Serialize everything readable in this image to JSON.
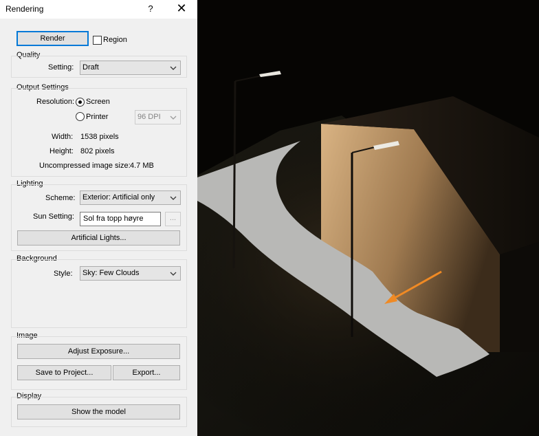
{
  "window": {
    "title": "Rendering",
    "help_glyph": "?",
    "close_glyph": "✕"
  },
  "render": {
    "button_label": "Render",
    "region_label": "Region",
    "region_checked": false
  },
  "quality": {
    "group_title": "Quality",
    "setting_label": "Setting:",
    "setting_value": "Draft"
  },
  "output": {
    "group_title": "Output Settings",
    "resolution_label": "Resolution:",
    "screen_label": "Screen",
    "printer_label": "Printer",
    "selected": "Screen",
    "dpi_value": "96 DPI",
    "width_label": "Width:",
    "width_value": "1538 pixels",
    "height_label": "Height:",
    "height_value": "802 pixels",
    "size_label": "Uncompressed image size:",
    "size_value": "4.7 MB"
  },
  "lighting": {
    "group_title": "Lighting",
    "scheme_label": "Scheme:",
    "scheme_value": "Exterior: Artificial only",
    "sun_label": "Sun Setting:",
    "sun_value": "Sol fra topp høyre",
    "browse_label": "...",
    "artificial_button": "Artificial Lights..."
  },
  "background": {
    "group_title": "Background",
    "style_label": "Style:",
    "style_value": "Sky: Few Clouds"
  },
  "image": {
    "group_title": "Image",
    "exposure_button": "Adjust Exposure...",
    "save_button": "Save to Project...",
    "export_button": "Export..."
  },
  "display": {
    "group_title": "Display",
    "show_model_button": "Show the model"
  },
  "colors": {
    "accent": "#0078d7",
    "annotation_arrow": "#f08a24",
    "viewport_bg": "#050402"
  }
}
